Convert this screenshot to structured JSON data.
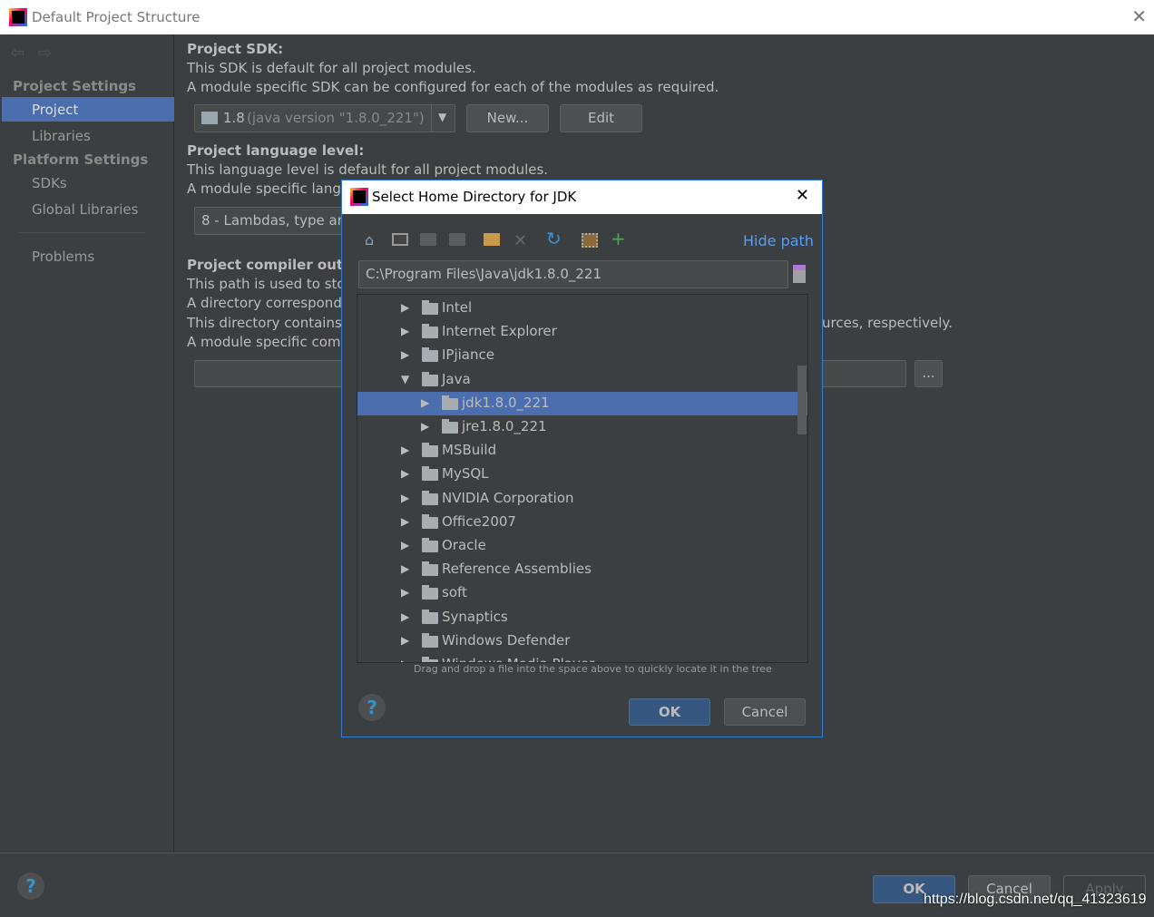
{
  "window": {
    "title": "Default Project Structure"
  },
  "sidebar": {
    "sections": [
      {
        "label": "Project Settings",
        "items": [
          "Project",
          "Libraries"
        ]
      },
      {
        "label": "Platform Settings",
        "items": [
          "SDKs",
          "Global Libraries"
        ]
      }
    ],
    "problems": "Problems",
    "selected": "Project"
  },
  "main": {
    "sdk_heading": "Project SDK:",
    "sdk_desc1": "This SDK is default for all project modules.",
    "sdk_desc2": "A module specific SDK can be configured for each of the modules as required.",
    "sdk_value": "1.8",
    "sdk_version": "(java version \"1.8.0_221\")",
    "new_button": "New...",
    "edit_button": "Edit",
    "lang_heading": "Project language level:",
    "lang_desc1": "This language level is default for all project modules.",
    "lang_desc2": "A module specific langu",
    "lang_value": "8 - Lambdas, type ann",
    "compiler_heading": "Project compiler outpu",
    "comp_desc1": "This path is used to stor",
    "comp_desc2": "A directory correspond",
    "comp_desc3": "This directory contains",
    "comp_desc3_tail": "urces, respectively.",
    "comp_desc4": "A module specific comp",
    "browse_button": "..."
  },
  "footer": {
    "ok": "OK",
    "cancel": "Cancel",
    "apply": "Apply",
    "watermark": "https://blog.csdn.net/qq_41323619"
  },
  "dialog": {
    "title": "Select Home Directory for JDK",
    "hide_path": "Hide path",
    "path": "C:\\Program Files\\Java\\jdk1.8.0_221",
    "hint": "Drag and drop a file into the space above to quickly locate it in the tree",
    "ok": "OK",
    "cancel": "Cancel",
    "tree": [
      {
        "label": "Intel",
        "level": 1,
        "expanded": false
      },
      {
        "label": "Internet Explorer",
        "level": 1,
        "expanded": false
      },
      {
        "label": "IPjiance",
        "level": 1,
        "expanded": false
      },
      {
        "label": "Java",
        "level": 1,
        "expanded": true
      },
      {
        "label": "jdk1.8.0_221",
        "level": 2,
        "expanded": false,
        "selected": true
      },
      {
        "label": "jre1.8.0_221",
        "level": 2,
        "expanded": false
      },
      {
        "label": "MSBuild",
        "level": 1,
        "expanded": false
      },
      {
        "label": "MySQL",
        "level": 1,
        "expanded": false
      },
      {
        "label": "NVIDIA Corporation",
        "level": 1,
        "expanded": false
      },
      {
        "label": "Office2007",
        "level": 1,
        "expanded": false
      },
      {
        "label": "Oracle",
        "level": 1,
        "expanded": false
      },
      {
        "label": "Reference Assemblies",
        "level": 1,
        "expanded": false
      },
      {
        "label": "soft",
        "level": 1,
        "expanded": false
      },
      {
        "label": "Synaptics",
        "level": 1,
        "expanded": false
      },
      {
        "label": "Windows Defender",
        "level": 1,
        "expanded": false
      },
      {
        "label": "Windows Media Player",
        "level": 1,
        "expanded": false
      }
    ]
  },
  "colors": {
    "accent": "#4b6eaf",
    "link": "#589df6",
    "bg": "#3c3f41"
  }
}
